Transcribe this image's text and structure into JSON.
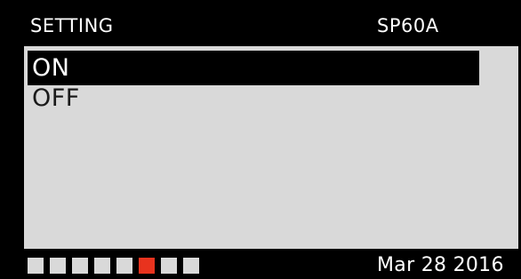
{
  "header": {
    "title": "SETTING",
    "code": "SP60A"
  },
  "menu": {
    "options": [
      {
        "label": "ON",
        "selected": true
      },
      {
        "label": "OFF",
        "selected": false
      }
    ]
  },
  "footer": {
    "page_count": 8,
    "active_page": 6,
    "date": "Mar 28 2016"
  },
  "colors": {
    "background": "#000000",
    "panel": "#d9d9d9",
    "selection": "#000000",
    "active_indicator": "#e8331e",
    "inactive_indicator": "#d9d9d9"
  }
}
